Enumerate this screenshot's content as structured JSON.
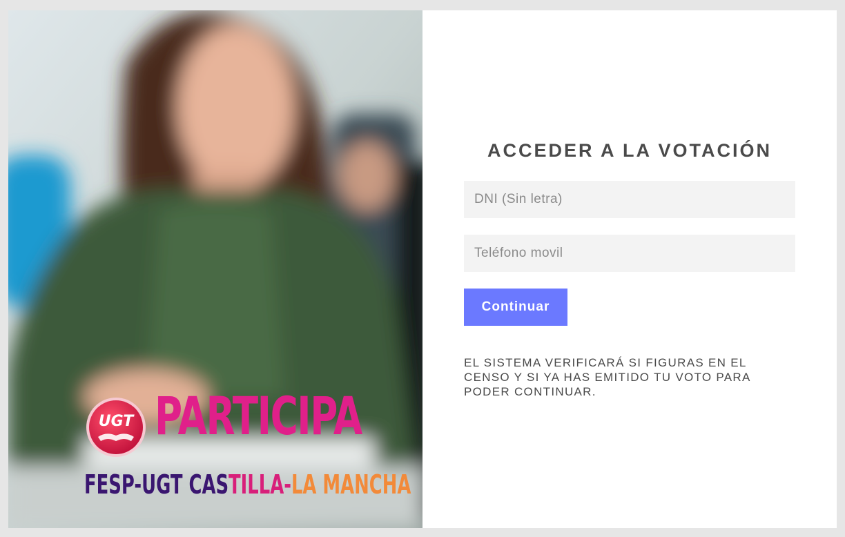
{
  "hero": {
    "logo_text": "UGT",
    "headline": "PARTICIPA",
    "subline_part1": "FESP-UGT CAS",
    "subline_part2": "TILLA-",
    "subline_part3": "LA MANCHA"
  },
  "form": {
    "title": "ACCEDER A LA VOTACIÓN",
    "dni_placeholder": "DNI (Sin letra)",
    "phone_placeholder": "Teléfono movil",
    "continue_label": "Continuar",
    "notice": "EL SISTEMA VERIFICARÁ SI FIGURAS EN EL CENSO Y SI YA HAS EMITIDO TU VOTO PARA PODER CONTINUAR."
  },
  "colors": {
    "button": "#6b79ff",
    "input_bg": "#f3f3f3",
    "title_text": "#4a4a4a",
    "brand_pink": "#e0208a",
    "brand_purple": "#3a1670",
    "brand_orange": "#f28a3a"
  }
}
